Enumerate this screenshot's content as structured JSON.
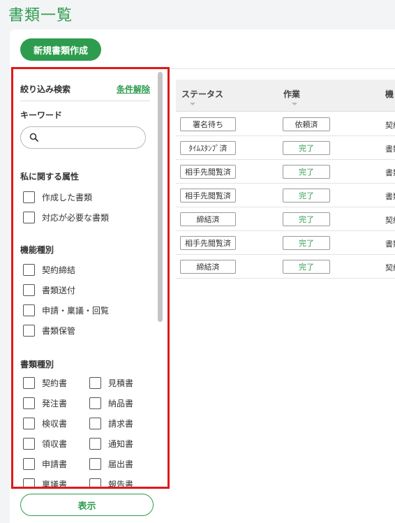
{
  "page_title": "書類一覧",
  "new_doc_button": "新規書類作成",
  "show_button": "表示",
  "filter": {
    "title": "絞り込み検索",
    "clear": "条件解除",
    "keyword_title": "キーワード",
    "search_placeholder": "",
    "attr_title": "私に関する属性",
    "attr_items": [
      "作成した書類",
      "対応が必要な書類"
    ],
    "func_title": "機能種別",
    "func_items": [
      "契約締結",
      "書類送付",
      "申請・稟議・回覧",
      "書類保管"
    ],
    "doctype_title": "書類種別",
    "doctype_left": [
      "契約書",
      "発注書",
      "検収書",
      "領収書",
      "申請書",
      "稟議書"
    ],
    "doctype_right": [
      "見積書",
      "納品書",
      "請求書",
      "通知書",
      "届出書",
      "報告書"
    ]
  },
  "table": {
    "headers": [
      "ステータス",
      "作業",
      "機"
    ],
    "rows": [
      {
        "status": "署名待ち",
        "work": "依頼済",
        "work_done": false,
        "func": "契約"
      },
      {
        "status": "ﾀｲﾑｽﾀﾝﾌﾟ済",
        "work": "完了",
        "work_done": true,
        "func": "書類"
      },
      {
        "status": "相手先閲覧済",
        "work": "完了",
        "work_done": true,
        "func": "書類"
      },
      {
        "status": "相手先閲覧済",
        "work": "完了",
        "work_done": true,
        "func": "書類"
      },
      {
        "status": "締結済",
        "work": "完了",
        "work_done": true,
        "func": "契約"
      },
      {
        "status": "相手先閲覧済",
        "work": "完了",
        "work_done": true,
        "func": "書類"
      },
      {
        "status": "締結済",
        "work": "完了",
        "work_done": true,
        "func": "契約"
      }
    ]
  },
  "colors": {
    "accent": "#2e9c4e",
    "highlight": "#e01919"
  }
}
